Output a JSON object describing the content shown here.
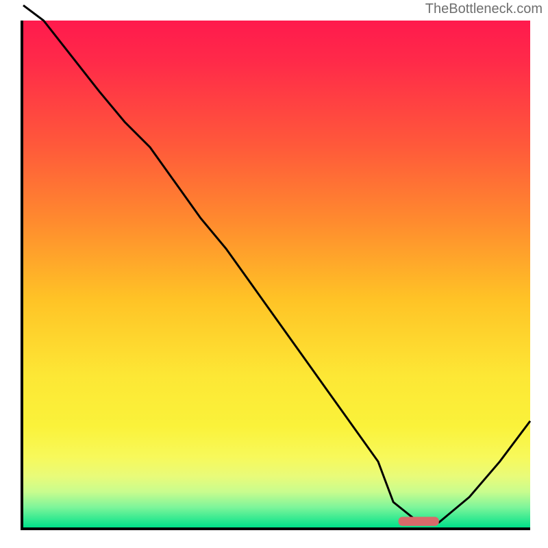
{
  "watermark": "TheBottleneck.com",
  "colors": {
    "top": "#ff1a4d",
    "mid": "#ffc326",
    "bottom": "#00e18a",
    "marker": "#d86a6a"
  },
  "chart_data": {
    "type": "line",
    "title": "",
    "xlabel": "",
    "ylabel": "",
    "xlim": [
      0,
      100
    ],
    "ylim": [
      0,
      100
    ],
    "grid": false,
    "x": [
      0,
      4,
      15,
      20,
      25,
      30,
      35,
      40,
      45,
      50,
      55,
      60,
      65,
      70,
      73,
      78,
      82,
      88,
      94,
      100
    ],
    "y": [
      103,
      100,
      86,
      80,
      75,
      68,
      61,
      55,
      48,
      41,
      34,
      27,
      20,
      13,
      5,
      1,
      1,
      6,
      13,
      21
    ],
    "marker": {
      "x_start": 74,
      "x_end": 82,
      "y": 1.2
    },
    "annotations": []
  }
}
